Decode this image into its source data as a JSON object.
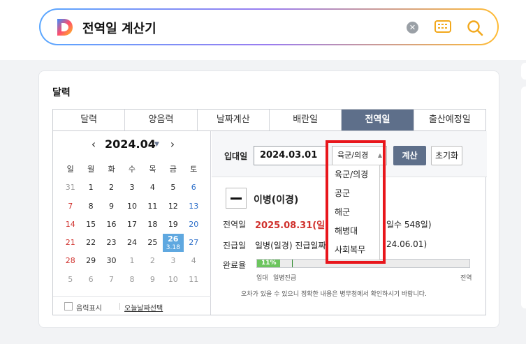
{
  "search": {
    "query": "전역일 계산기",
    "clear_icon": "clear-icon",
    "keyboard_icon": "keyboard-icon",
    "search_icon": "search-icon"
  },
  "card": {
    "title": "달력"
  },
  "tabs": [
    {
      "label": "달력"
    },
    {
      "label": "양음력"
    },
    {
      "label": "날짜계산"
    },
    {
      "label": "배란일"
    },
    {
      "label": "전역일",
      "active": true
    },
    {
      "label": "출산예정일"
    }
  ],
  "calendar": {
    "month": "2024.04",
    "weekdays": [
      "일",
      "월",
      "화",
      "수",
      "목",
      "금",
      "토"
    ],
    "weeks": [
      [
        "31",
        "1",
        "2",
        "3",
        "4",
        "5",
        "6"
      ],
      [
        "7",
        "8",
        "9",
        "10",
        "11",
        "12",
        "13"
      ],
      [
        "14",
        "15",
        "16",
        "17",
        "18",
        "19",
        "20"
      ],
      [
        "21",
        "22",
        "23",
        "24",
        "25",
        "26",
        "27"
      ],
      [
        "28",
        "29",
        "30",
        "1",
        "2",
        "3",
        "4"
      ],
      [
        "5",
        "6",
        "7",
        "8",
        "9",
        "10",
        "11"
      ]
    ],
    "today": {
      "day": "26",
      "lunar": "3.18"
    },
    "lunar_toggle_label": "음력표시",
    "today_link": "오늘날짜선택"
  },
  "calculator": {
    "enlist_label": "입대일",
    "enlist_date": "2024.03.01",
    "branch_selected": "육군/의경",
    "calc_button": "계산",
    "reset_button": "초기화",
    "rank": "이병(이경)",
    "discharge_label": "전역일",
    "discharge_date": "2025.08.31(일)",
    "days_text": "일수 548일)",
    "promo_label": "진급일",
    "promo_text": "일병(일경) 진급일짜",
    "promo_date": "24.06.01)",
    "progress_label": "완료율",
    "progress_percent": "11%",
    "progress_value": 11,
    "tick_enlist": "입대",
    "tick_private": "일병진급",
    "tick_discharge": "전역",
    "notice": "오차가 있을 수 있으니 정확한 내용은 병무청에서 확인하시기 바랍니다."
  },
  "dropdown": {
    "options": [
      "육군/의경",
      "공군",
      "해군",
      "해병대",
      "사회복무"
    ]
  }
}
